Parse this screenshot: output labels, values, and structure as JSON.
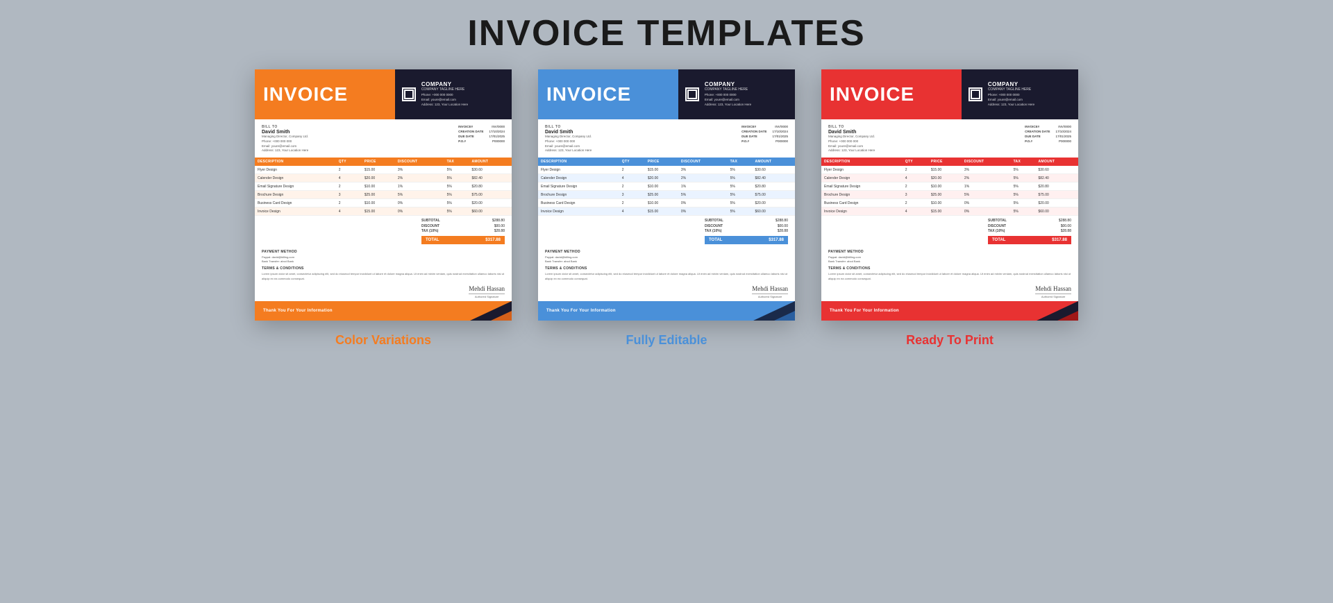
{
  "page": {
    "title": "INVOICE TEMPLATES"
  },
  "company": {
    "name": "COMPANY",
    "tagline": "COMPANY TAGLINE HERE",
    "phone": "Phone: +000 000 0000",
    "email": "Email: youre@email.com",
    "address": "Address: 123, Your Location Here"
  },
  "bill_to": {
    "label": "BILL TO",
    "name": "David Smith",
    "title": "Managing Director, Company Ltd.",
    "phone": "Phone: +000 000 000",
    "email": "Email: youre@email.com",
    "address": "Address: 123, Your Location Here"
  },
  "invoice_meta": {
    "invoice_label": "INVOICE#",
    "invoice_num": "INV/0000",
    "creation_label": "CREATION DATE",
    "creation_date": "17/10/2024",
    "due_label": "DUE DATE",
    "due_date": "17/01/2025",
    "po_label": "P.O.#",
    "po_num": "P000000"
  },
  "table": {
    "headers": [
      "DESCRIPTION",
      "QTY",
      "PRICE",
      "DISCOUNT",
      "TAX",
      "AMOUNT"
    ],
    "rows": [
      [
        "Flyer Design",
        "2",
        "$15.00",
        "3%",
        "5%",
        "$30.60"
      ],
      [
        "Calender Design",
        "4",
        "$20.00",
        "2%",
        "5%",
        "$82.40"
      ],
      [
        "Email Signature Design",
        "2",
        "$10.00",
        "1%",
        "5%",
        "$20.80"
      ],
      [
        "Brochure Design",
        "3",
        "$25.00",
        "5%",
        "5%",
        "$75.00"
      ],
      [
        "Business Card Design",
        "2",
        "$10.00",
        "0%",
        "5%",
        "$20.00"
      ],
      [
        "Invoice Design",
        "4",
        "$15.00",
        "0%",
        "5%",
        "$60.00"
      ]
    ]
  },
  "totals": {
    "subtotal_label": "SUBTOTAL",
    "subtotal_val": "$288.80",
    "discount_label": "DISCOUNT",
    "discount_val": "$00.00",
    "tax_label": "TAX (10%)",
    "tax_val": "$28.88",
    "total_label": "TOTAL",
    "total_val": "$317.88"
  },
  "payment": {
    "label": "PAYMENT METHOD",
    "line1": "Paypal: david@billing.com",
    "line2": "Bank Transfer: abcd Bank"
  },
  "terms": {
    "label": "TERMS & CONDITIONS",
    "text": "Lorem ipsum dolor sit amet, consectetur adipiscing elit, sed do eiusmod tempor incididunt ut labore et dolore magna aliqua. Ut enim ad minim veniam, quis nostrud exercitation ullamco laboris nisi ut aliquip ex ea commodo consequat."
  },
  "signature": {
    "text": "Mehdi Hassan",
    "label": "Authored Signature"
  },
  "footer": {
    "text": "Thank You For Your Information"
  },
  "footer_labels": {
    "orange": "Color Variations",
    "blue": "Fully Editable",
    "red": "Ready To Print"
  },
  "colors": {
    "orange": "#f47c20",
    "blue": "#4a90d9",
    "red": "#e83232",
    "dark": "#1a1a2e"
  }
}
